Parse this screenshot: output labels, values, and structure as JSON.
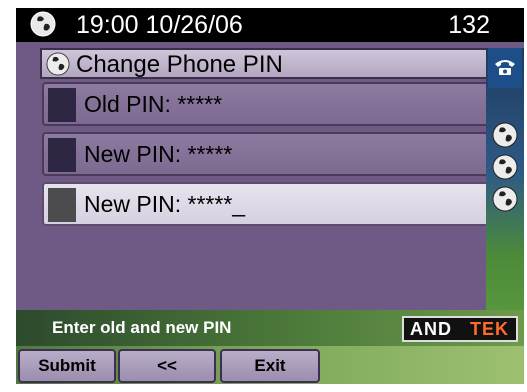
{
  "header": {
    "time_date": "19:00 10/26/06",
    "extension": "132"
  },
  "title": "Change Phone PIN",
  "rows": [
    {
      "label": "Old PIN:",
      "value": "*****"
    },
    {
      "label": "New PIN:",
      "value": "*****"
    },
    {
      "label": "New PIN:",
      "value": "*****_"
    }
  ],
  "status": {
    "message": "Enter old and new PIN",
    "logo_left": "AND",
    "logo_right": "TEK"
  },
  "softkeys": [
    "Submit",
    "<<",
    "Exit"
  ],
  "colors": {
    "logo_accent": "#ff6b2a",
    "background": "#6f5a85"
  },
  "icons": {
    "globe": "globe-icon",
    "phone": "phone-icon"
  }
}
